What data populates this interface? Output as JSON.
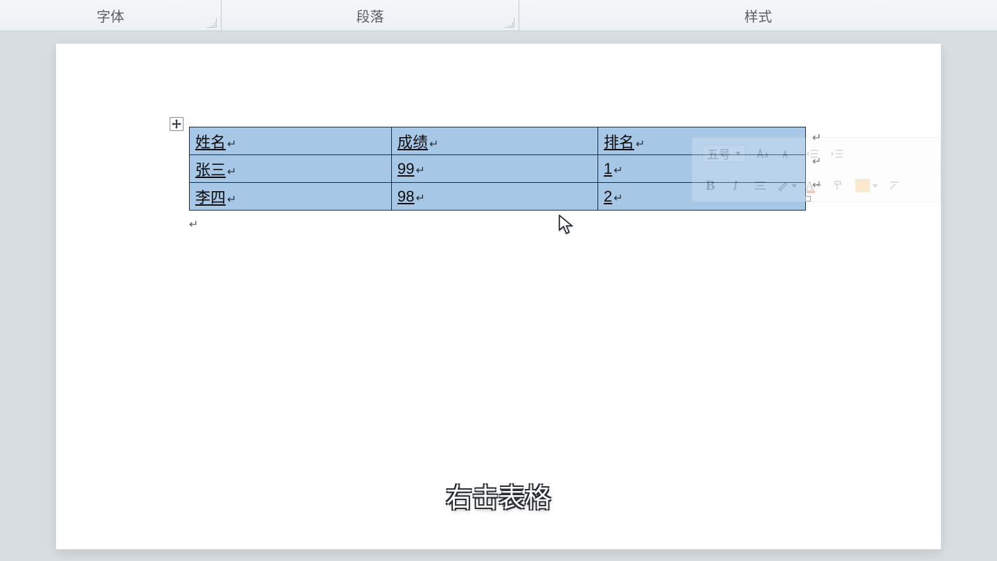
{
  "ribbon": {
    "font_label": "字体",
    "paragraph_label": "段落",
    "styles_label": "样式"
  },
  "mini_toolbar": {
    "font_size_label": "五号",
    "bold": "B",
    "italic": "I",
    "font_color_glyph": "A"
  },
  "table": {
    "headers": [
      "姓名",
      "成绩",
      "排名"
    ],
    "rows": [
      {
        "name": "张三",
        "score": "99",
        "rank": "1"
      },
      {
        "name": "李四",
        "score": "98",
        "rank": "2"
      }
    ]
  },
  "caption": "右击表格",
  "glyphs": {
    "pilcrow": "↵"
  }
}
